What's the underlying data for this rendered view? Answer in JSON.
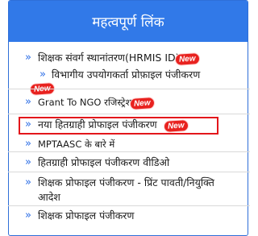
{
  "header": {
    "title": "महत्वपूर्ण लिंक"
  },
  "links": [
    {
      "label": "शिक्षक संवर्ग स्थानांतरण(HRMIS ID)",
      "badge": "New"
    },
    {
      "label": "विभागीय उपयोगकर्ता प्रोफ़ाइल पंजीकरण"
    },
    {
      "label": "Grant To NGO रजिस्ट्रेशन",
      "badge": "New",
      "badge2": "New"
    },
    {
      "label": "नया हितग्राही प्रोफाइल पंजीकरण",
      "badge": "New"
    },
    {
      "label": "MPTAASC के बारे में"
    },
    {
      "label": "हितग्राही प्रोफाइल पंजीकरण वीडिओ"
    },
    {
      "label_line1": "शिक्षक प्रोफाइल पंजीकरण - प्रिंट पावती/नियुक्ति",
      "label_line2": "आदेश"
    },
    {
      "label": "शिक्षक प्रोफाइल पंजीकरण"
    }
  ],
  "colors": {
    "header_bg": "#3179e8",
    "badge": "#e8221f",
    "highlight_border": "#e3161b",
    "arrow": "#2c6ee6"
  }
}
